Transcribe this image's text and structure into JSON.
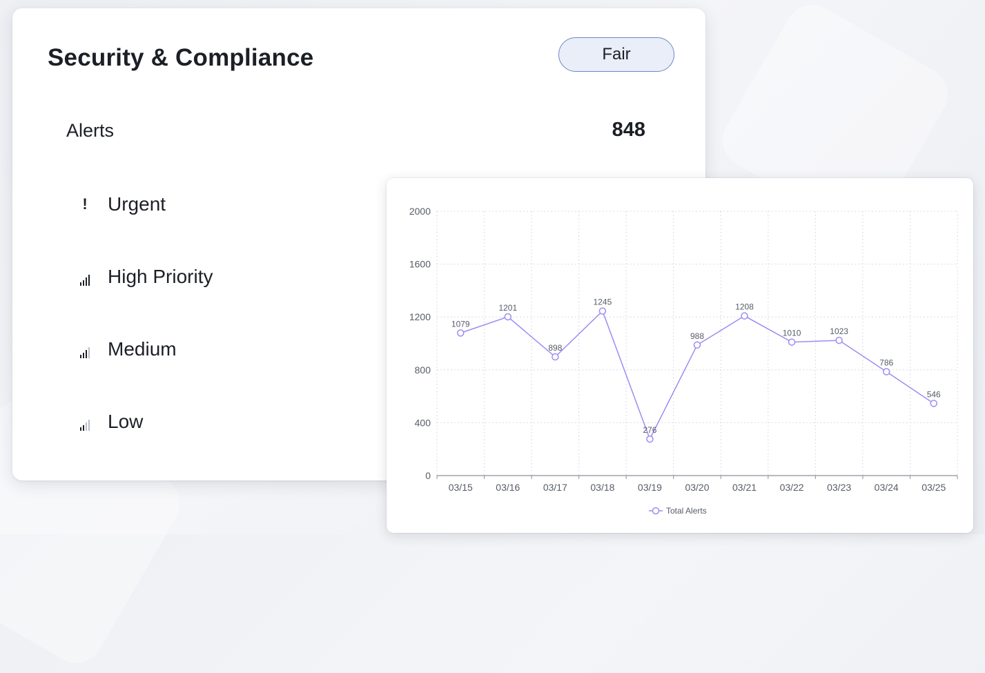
{
  "card": {
    "title": "Security & Compliance",
    "status_badge": "Fair",
    "alerts_label": "Alerts",
    "alerts_count": "848",
    "categories": [
      {
        "label": "Urgent",
        "icon": "exclamation-icon"
      },
      {
        "label": "High Priority",
        "icon": "signal-bars-4-icon",
        "level": 4
      },
      {
        "label": "Medium",
        "icon": "signal-bars-3-icon",
        "level": 3
      },
      {
        "label": "Low",
        "icon": "signal-bars-2-icon",
        "level": 2
      }
    ]
  },
  "colors": {
    "line": "#9c8cf3",
    "badge_border": "#6f86c8",
    "badge_fill": "#e9eef9",
    "text": "#1c1f26"
  },
  "chart_data": {
    "type": "line",
    "categories": [
      "03/15",
      "03/16",
      "03/17",
      "03/18",
      "03/19",
      "03/20",
      "03/21",
      "03/22",
      "03/23",
      "03/24",
      "03/25"
    ],
    "series": [
      {
        "name": "Total Alerts",
        "values": [
          1079,
          1201,
          898,
          1245,
          276,
          988,
          1208,
          1010,
          1023,
          786,
          546
        ]
      }
    ],
    "yticks": [
      0,
      400,
      800,
      1200,
      1600,
      2000
    ],
    "ylim": [
      0,
      2000
    ],
    "grid": true,
    "legend": "bottom-center",
    "data_labels": true
  }
}
